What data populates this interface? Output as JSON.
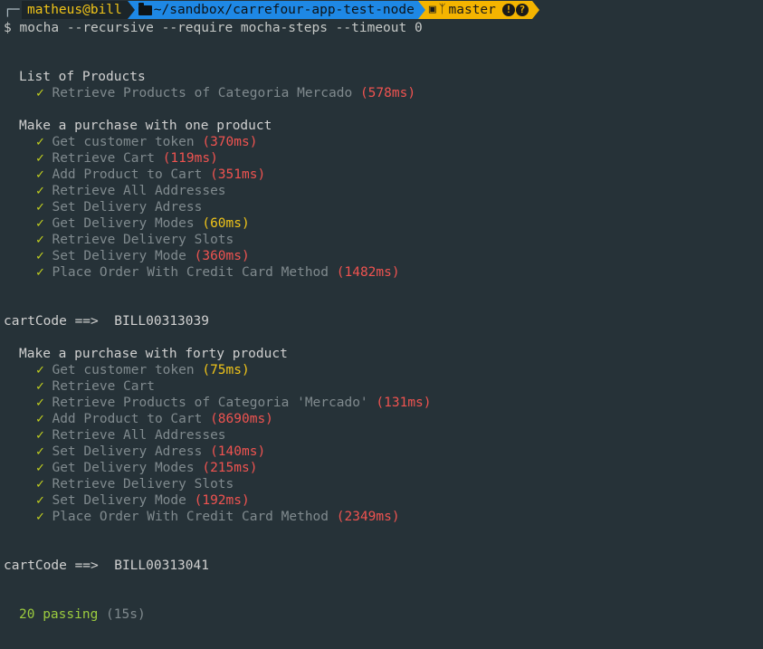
{
  "prompt": {
    "corner": "┌─",
    "user": "matheus@bill",
    "path": "~/sandbox/carrefour-app-test-node",
    "git_icon": "git-branch-icon",
    "branch": "master",
    "status_badges": [
      "!",
      "?"
    ]
  },
  "command": {
    "dollar": "$",
    "name": "mocha",
    "args": " --recursive --require mocha-steps --timeout 0"
  },
  "check_mark": "✓",
  "suites": [
    {
      "title": "List of Products",
      "tests": [
        {
          "name": "Retrieve Products of Categoria Mercado",
          "duration": "(578ms)",
          "speed": "slow"
        }
      ]
    },
    {
      "title": "Make a purchase with one product",
      "tests": [
        {
          "name": "Get customer token",
          "duration": "(370ms)",
          "speed": "slow"
        },
        {
          "name": "Retrieve Cart",
          "duration": "(119ms)",
          "speed": "slow"
        },
        {
          "name": "Add Product to Cart",
          "duration": "(351ms)",
          "speed": "slow"
        },
        {
          "name": "Retrieve All Addresses",
          "duration": "",
          "speed": ""
        },
        {
          "name": "Set Delivery Adress",
          "duration": "",
          "speed": ""
        },
        {
          "name": "Get Delivery Modes",
          "duration": "(60ms)",
          "speed": "medium"
        },
        {
          "name": "Retrieve Delivery Slots",
          "duration": "",
          "speed": ""
        },
        {
          "name": "Set Delivery Mode",
          "duration": "(360ms)",
          "speed": "slow"
        },
        {
          "name": "Place Order With Credit Card Method",
          "duration": "(1482ms)",
          "speed": "slow"
        }
      ],
      "output": "cartCode ==>  BILL00313039"
    },
    {
      "title": "Make a purchase with forty product",
      "tests": [
        {
          "name": "Get customer token",
          "duration": "(75ms)",
          "speed": "medium"
        },
        {
          "name": "Retrieve Cart",
          "duration": "",
          "speed": ""
        },
        {
          "name": "Retrieve Products of Categoria 'Mercado'",
          "duration": "(131ms)",
          "speed": "slow"
        },
        {
          "name": "Add Product to Cart",
          "duration": "(8690ms)",
          "speed": "slow"
        },
        {
          "name": "Retrieve All Addresses",
          "duration": "",
          "speed": ""
        },
        {
          "name": "Set Delivery Adress",
          "duration": "(140ms)",
          "speed": "slow"
        },
        {
          "name": "Get Delivery Modes",
          "duration": "(215ms)",
          "speed": "slow"
        },
        {
          "name": "Retrieve Delivery Slots",
          "duration": "",
          "speed": ""
        },
        {
          "name": "Set Delivery Mode",
          "duration": "(192ms)",
          "speed": "slow"
        },
        {
          "name": "Place Order With Credit Card Method",
          "duration": "(2349ms)",
          "speed": "slow"
        }
      ],
      "output": "cartCode ==>  BILL00313041"
    }
  ],
  "summary": {
    "passing": "20 passing",
    "duration": "(15s)"
  },
  "colors": {
    "background": "#263238",
    "check": "#c8d61e",
    "slow": "#ef5350",
    "medium": "#f0c419",
    "passing": "#9ccc3e"
  }
}
